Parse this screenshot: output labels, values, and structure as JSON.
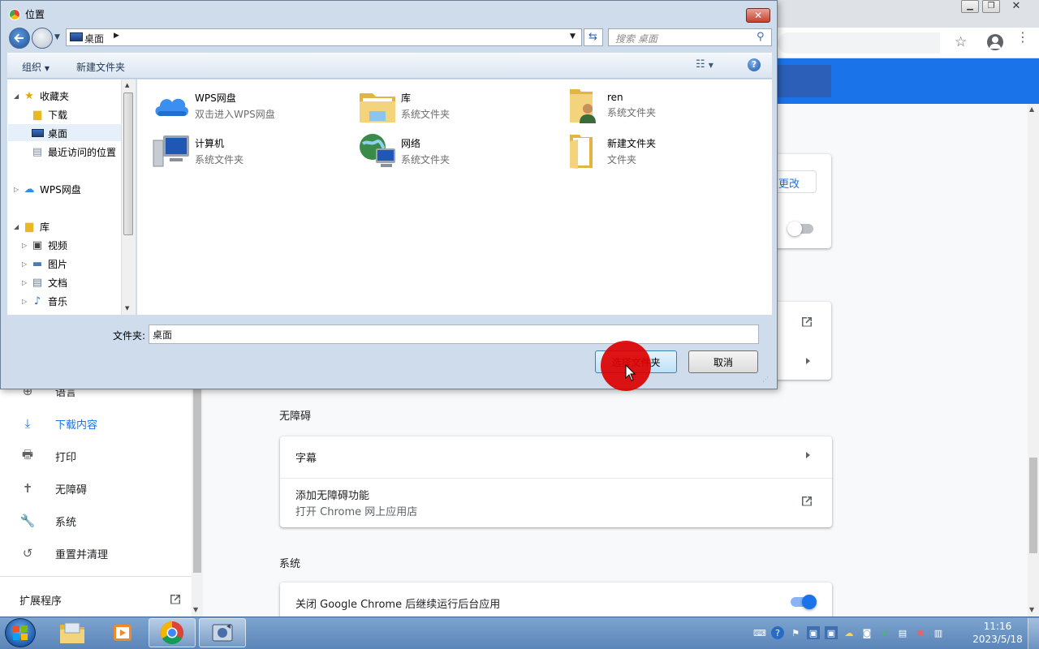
{
  "dialog": {
    "title": "位置",
    "address": "桌面",
    "search_placeholder": "搜索 桌面",
    "toolbar": {
      "organize": "组织",
      "new_folder": "新建文件夹"
    },
    "nav_tree": [
      {
        "label": "收藏夹",
        "icon": "star-icon"
      },
      {
        "label": "下载",
        "icon": "download-folder-icon"
      },
      {
        "label": "桌面",
        "icon": "desktop-icon"
      },
      {
        "label": "最近访问的位置",
        "icon": "recent-places-icon"
      },
      {
        "label": "WPS网盘",
        "icon": "wps-cloud-icon"
      },
      {
        "label": "库",
        "icon": "library-icon"
      },
      {
        "label": "视频",
        "icon": "video-library-icon"
      },
      {
        "label": "图片",
        "icon": "pictures-library-icon"
      },
      {
        "label": "文档",
        "icon": "documents-library-icon"
      },
      {
        "label": "音乐",
        "icon": "music-library-icon"
      }
    ],
    "items": [
      {
        "name": "WPS网盘",
        "sub": "双击进入WPS网盘",
        "icon": "wps-cloud-icon"
      },
      {
        "name": "库",
        "sub": "系统文件夹",
        "icon": "library-folder-icon"
      },
      {
        "name": "ren",
        "sub": "系统文件夹",
        "icon": "user-folder-icon"
      },
      {
        "name": "计算机",
        "sub": "系统文件夹",
        "icon": "computer-icon"
      },
      {
        "name": "网络",
        "sub": "系统文件夹",
        "icon": "network-icon"
      },
      {
        "name": "新建文件夹",
        "sub": "文件夹",
        "icon": "folder-icon"
      }
    ],
    "folder_label": "文件夹:",
    "folder_value": "桌面",
    "select_button": "选择文件夹",
    "cancel_button": "取消"
  },
  "settings": {
    "change_button": "更改",
    "nav": [
      {
        "label": "语言",
        "icon": "globe-icon"
      },
      {
        "label": "下载内容",
        "icon": "download-icon",
        "active": true
      },
      {
        "label": "打印",
        "icon": "printer-icon"
      },
      {
        "label": "无障碍",
        "icon": "accessibility-icon"
      },
      {
        "label": "系统",
        "icon": "wrench-icon"
      },
      {
        "label": "重置并清理",
        "icon": "reset-icon"
      }
    ],
    "extensions": "扩展程序",
    "accessibility": {
      "title": "无障碍",
      "captions": "字幕",
      "add_features": "添加无障碍功能",
      "add_features_sub": "打开 Chrome 网上应用店"
    },
    "system": {
      "title": "系统",
      "background_apps": "关闭 Google Chrome 后继续运行后台应用",
      "background_apps_enabled": true
    }
  },
  "taskbar": {
    "time": "11:16",
    "date": "2023/5/18",
    "apps": [
      "file-explorer-icon",
      "media-player-icon",
      "chrome-icon",
      "paint-app-icon"
    ]
  },
  "colors": {
    "accent": "#1a73e8",
    "click_marker": "#dc0000"
  }
}
